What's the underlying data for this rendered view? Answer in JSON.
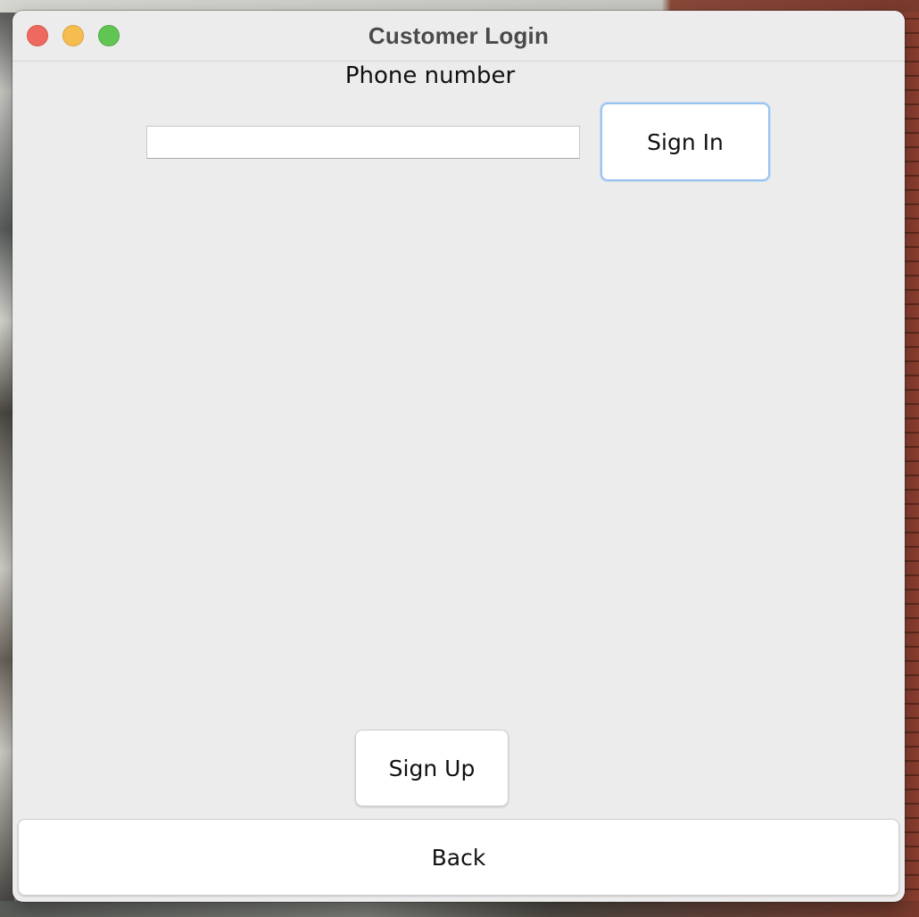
{
  "window": {
    "title": "Customer Login"
  },
  "form": {
    "phone_label": "Phone number",
    "phone_value": "",
    "sign_in_label": "Sign In"
  },
  "actions": {
    "sign_up_label": "Sign Up",
    "back_label": "Back"
  }
}
